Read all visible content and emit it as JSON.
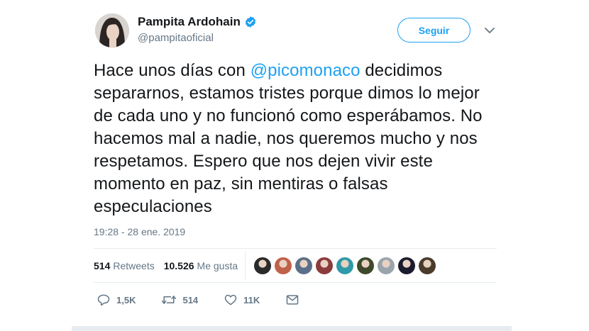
{
  "author": {
    "display_name": "Pampita Ardohain",
    "handle": "@pampitaoficial",
    "verified": true
  },
  "follow_button": {
    "label": "Seguir"
  },
  "tweet": {
    "text_before": "Hace unos días con ",
    "mention": "@picomonaco",
    "text_after": " decidimos separarnos, estamos tristes porque dimos lo mejor de cada uno y no funcionó como esperábamos. No hacemos mal a nadie, nos queremos mucho y nos respetamos. Espero que nos dejen vivir este momento en paz, sin mentiras o falsas especulaciones",
    "timestamp": "19:28 - 28 ene. 2019"
  },
  "stats": {
    "retweets_count": "514",
    "retweets_label": "Retweets",
    "likes_count": "10.526",
    "likes_label": "Me gusta"
  },
  "likers": [
    "#2a2a2a",
    "#c0614a",
    "#5b6f8a",
    "#8c3b3b",
    "#2f9aa8",
    "#3d4a2a",
    "#9aa4ad",
    "#1b1b2e",
    "#4a3b2a"
  ],
  "actions": {
    "reply_count": "1,5K",
    "retweet_count": "514",
    "like_count": "11K"
  },
  "colors": {
    "accent": "#1da1f2",
    "muted": "#657786",
    "text": "#14171a",
    "border": "#e6ecf0"
  },
  "icons": [
    "verified-badge-icon",
    "chevron-down-icon",
    "reply-icon",
    "retweet-icon",
    "heart-icon",
    "message-icon"
  ]
}
